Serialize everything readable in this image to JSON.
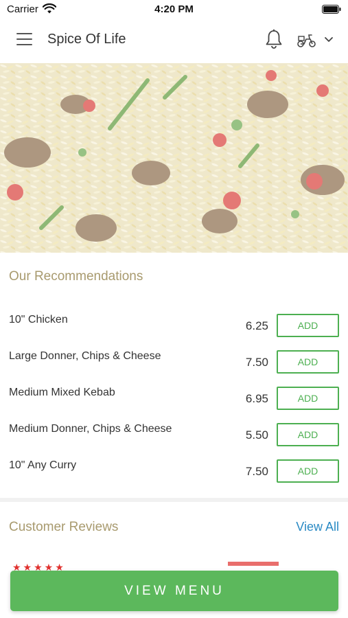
{
  "status_bar": {
    "carrier": "Carrier",
    "time": "4:20 PM",
    "icons": [
      "wifi-icon",
      "battery-icon"
    ]
  },
  "header": {
    "title": "Spice Of Life",
    "icons": [
      "menu-icon",
      "bell-icon",
      "scooter-icon",
      "chevron-down-icon"
    ]
  },
  "recommendations": {
    "title": "Our Recommendations",
    "items": [
      {
        "name": "10\" Chicken",
        "price": "6.25",
        "action": "ADD"
      },
      {
        "name": "Large Donner, Chips & Cheese",
        "price": "7.50",
        "action": "ADD"
      },
      {
        "name": "Medium Mixed Kebab",
        "price": "6.95",
        "action": "ADD"
      },
      {
        "name": "Medium Donner, Chips & Cheese",
        "price": "5.50",
        "action": "ADD"
      },
      {
        "name": "10\" Any Curry",
        "price": "7.50",
        "action": "ADD"
      }
    ]
  },
  "reviews": {
    "title": "Customer Reviews",
    "view_all": "View All",
    "stars": "★★★★★"
  },
  "footer": {
    "view_menu_label": "VIEW MENU"
  },
  "colors": {
    "accent_green": "#5cb85c",
    "add_green": "#4caf50",
    "section_title": "#a89a6e",
    "link_blue": "#2a8ac4",
    "star_red": "#e0312e"
  }
}
